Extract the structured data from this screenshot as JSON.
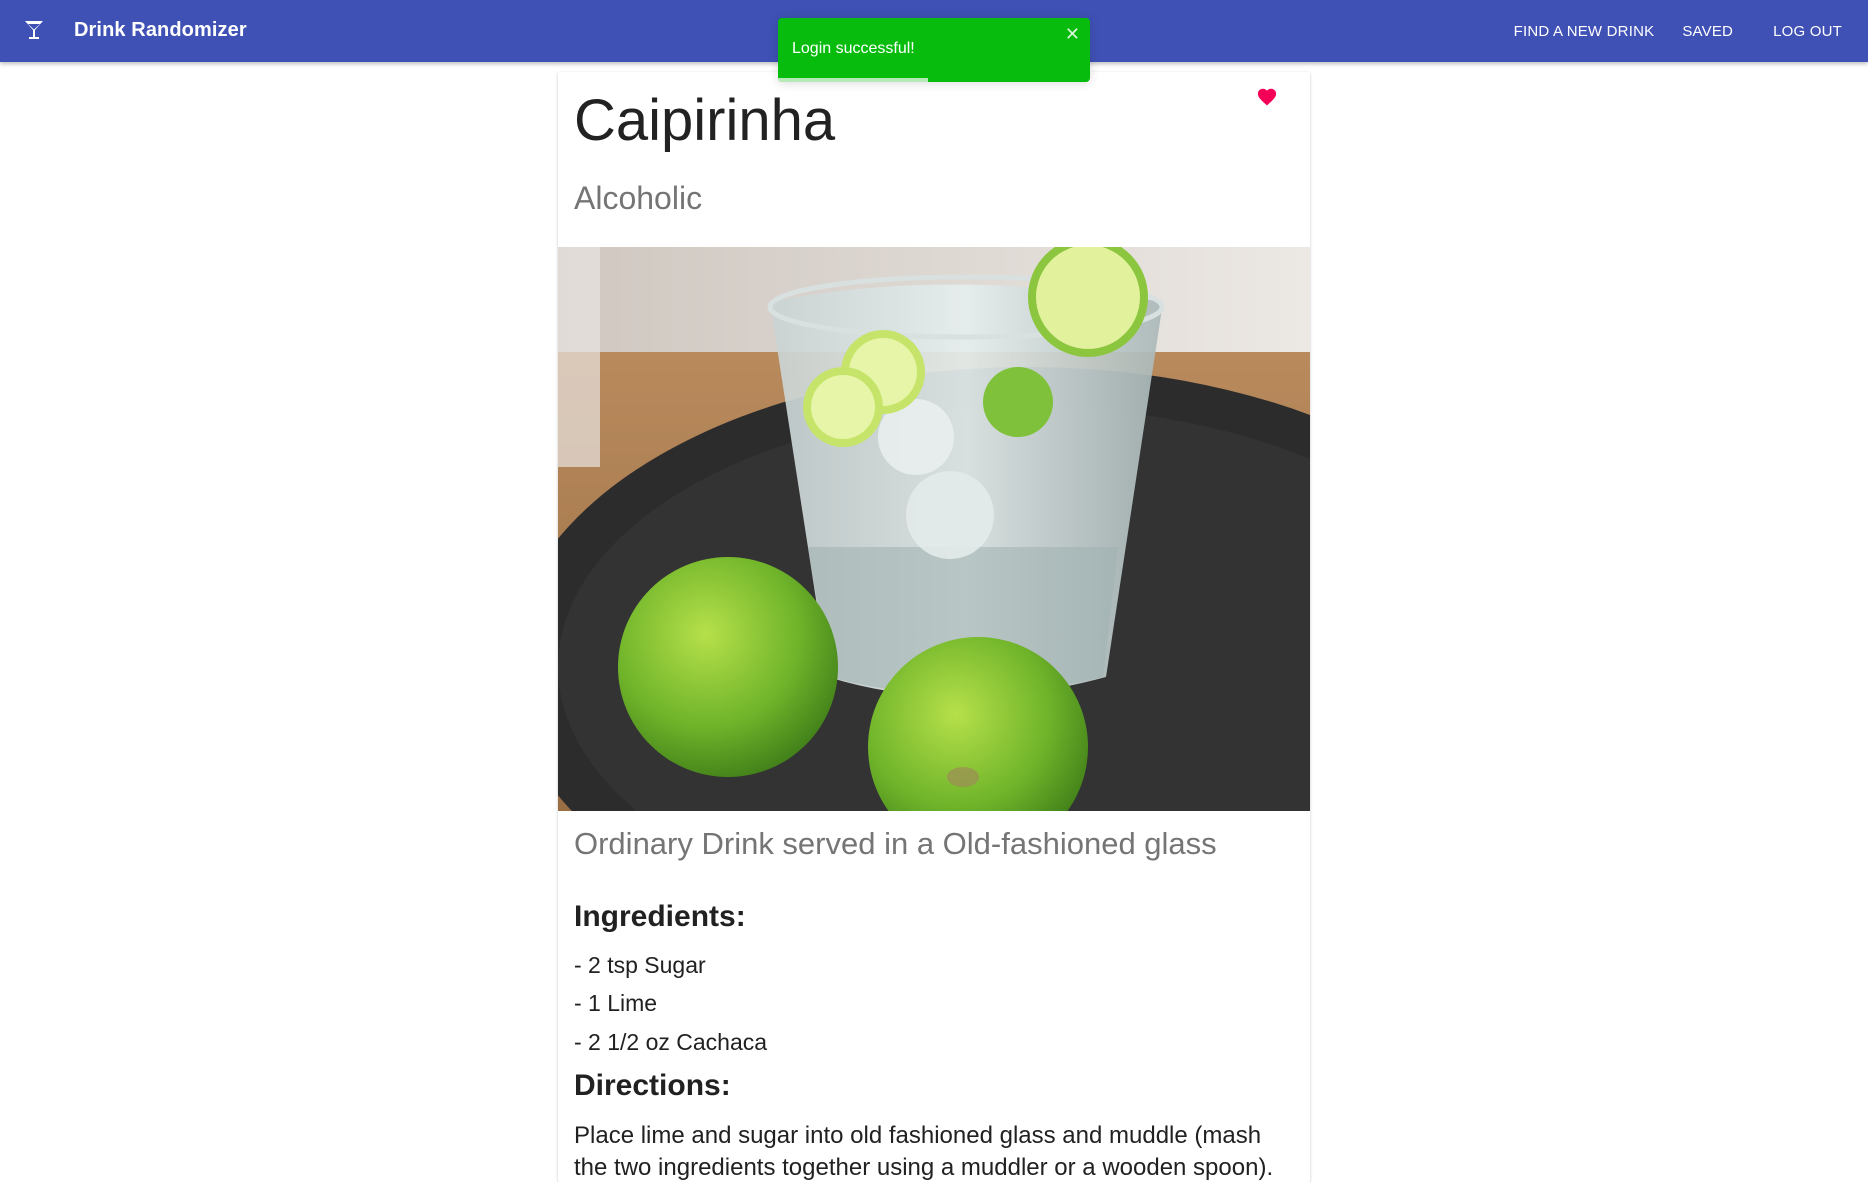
{
  "appbar": {
    "title": "Drink Randomizer",
    "nav": {
      "find": "FIND A NEW DRINK",
      "saved": "SAVED",
      "logout": "LOG OUT"
    },
    "color": "#3f51b5"
  },
  "toast": {
    "message": "Login successful!",
    "close": "✕",
    "color": "#07bc0c",
    "progress": 0.48
  },
  "drink": {
    "name": "Caipirinha",
    "alcoholic": "Alcoholic",
    "category_line": "Ordinary Drink served in a Old-fashioned glass",
    "ingredients_heading": "Ingredients:",
    "ingredients": [
      "- 2 tsp Sugar",
      "- 1 Lime",
      "- 2 1/2 oz Cachaca"
    ],
    "directions_heading": "Directions:",
    "directions": "Place lime and sugar into old fashioned glass and muddle (mash the two ingredients together using a muddler or a wooden spoon).",
    "favorite": true,
    "heart_color": "#f50057"
  },
  "icons": {
    "logo": "cocktail-icon",
    "favorite": "heart-icon",
    "close": "close-icon"
  }
}
